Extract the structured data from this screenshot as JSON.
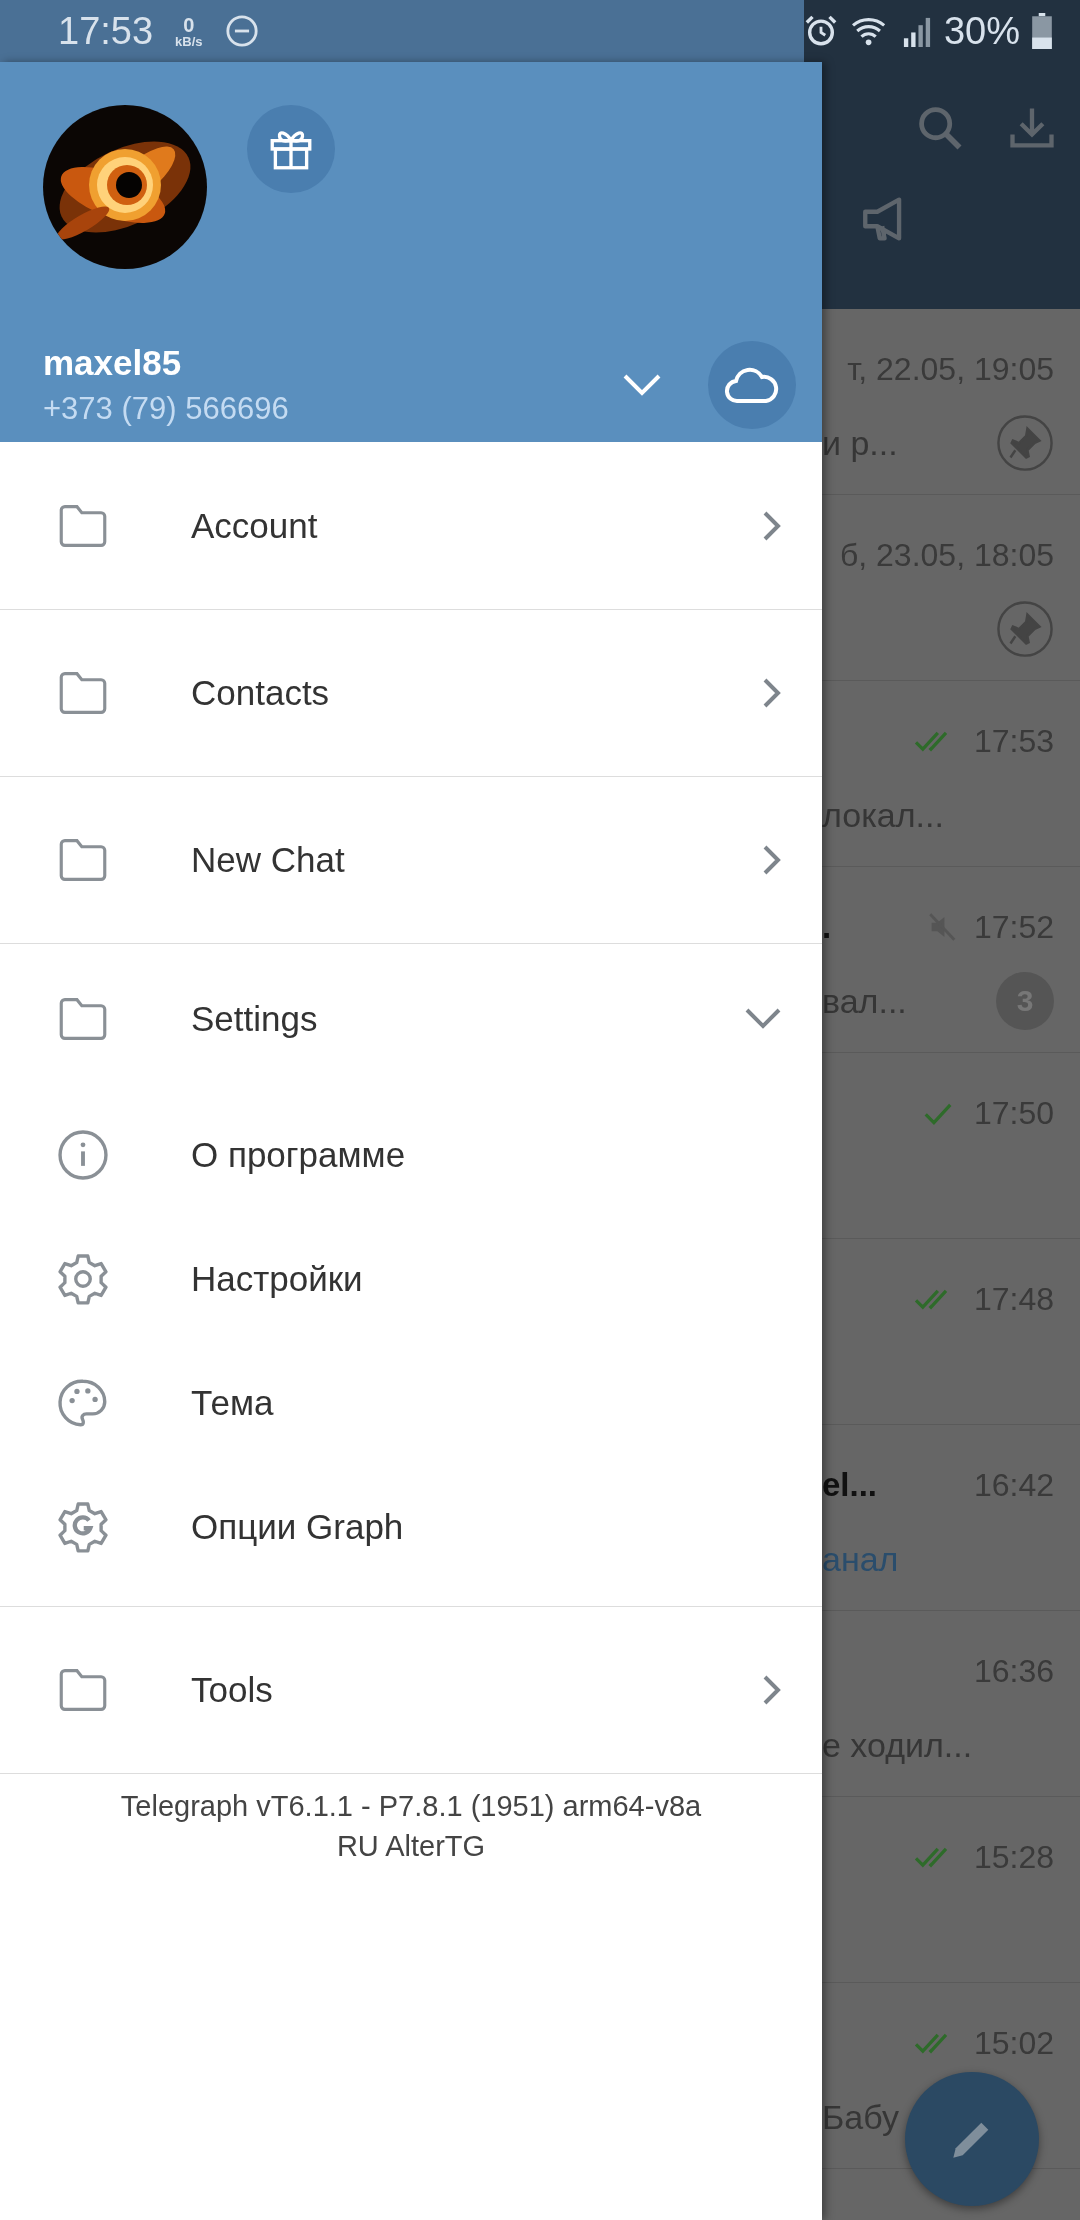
{
  "status_bar": {
    "time": "17:53",
    "net_speed": {
      "value": "0",
      "unit": "kB/s"
    },
    "battery": "30%"
  },
  "drawer": {
    "profile": {
      "name": "maxel85",
      "phone": "+373 (79) 566696"
    },
    "menu": [
      {
        "label": "Account",
        "kind": "folder",
        "expanded": false
      },
      {
        "label": "Contacts",
        "kind": "folder",
        "expanded": false
      },
      {
        "label": "New Chat",
        "kind": "folder",
        "expanded": false
      },
      {
        "label": "Settings",
        "kind": "folder",
        "expanded": true,
        "children": [
          {
            "label": "О программе",
            "kind": "info"
          },
          {
            "label": "Настройки",
            "kind": "gear"
          },
          {
            "label": "Тема",
            "kind": "palette"
          },
          {
            "label": "Опции Graph",
            "kind": "gear_g"
          }
        ]
      },
      {
        "label": "Tools",
        "kind": "folder",
        "expanded": false
      }
    ],
    "footer": [
      "Telegraph vT6.1.1 - P7.8.1 (1951) arm64-v8a",
      "RU AlterTG"
    ]
  },
  "chats": [
    {
      "time": "т, 22.05, 19:05",
      "preview": "и р...",
      "pinned": true
    },
    {
      "time": "б, 23.05, 18:05",
      "pinned": true
    },
    {
      "outgoing": true,
      "read": true,
      "time": "17:53",
      "preview": "локал..."
    },
    {
      "title": ".",
      "muted": true,
      "time": "17:52",
      "preview": "вал...",
      "unread": "3"
    },
    {
      "outgoing": true,
      "read": false,
      "time": "17:50"
    },
    {
      "outgoing": true,
      "read": true,
      "time": "17:48"
    },
    {
      "title": "el...",
      "time": "16:42",
      "preview": "анал",
      "preview_accent": true
    },
    {
      "time": "16:36",
      "preview": "е ходил..."
    },
    {
      "outgoing": true,
      "read": true,
      "time": "15:28"
    },
    {
      "outgoing": true,
      "read": true,
      "time": "15:02",
      "preview": "Бабу"
    }
  ]
}
